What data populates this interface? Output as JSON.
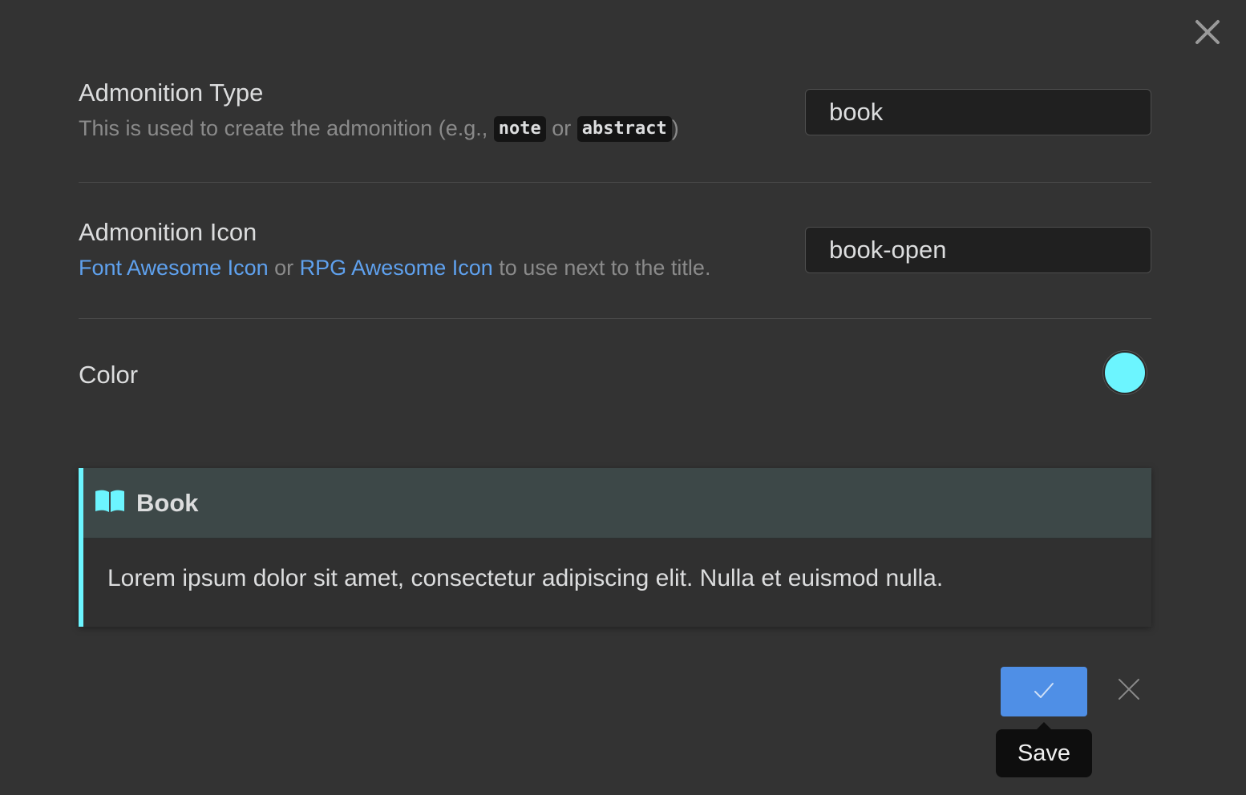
{
  "modal": {
    "close_icon": "close-icon"
  },
  "type_setting": {
    "name": "Admonition Type",
    "desc_prefix": "This is used to create the admonition (e.g., ",
    "code_1": "note",
    "desc_or": " or ",
    "code_2": "abstract",
    "desc_suffix": ")",
    "value": "book"
  },
  "icon_setting": {
    "name": "Admonition Icon",
    "link_1": "Font Awesome Icon",
    "desc_or": " or ",
    "link_2": "RPG Awesome Icon",
    "desc_suffix": " to use next to the title.",
    "value": "book-open"
  },
  "color_setting": {
    "name": "Color",
    "value": "#6cf5ff"
  },
  "preview": {
    "icon": "book-open-icon",
    "title": "Book",
    "content": "Lorem ipsum dolor sit amet, consectetur adipiscing elit. Nulla et euismod nulla.",
    "accent_color": "#6cf5ff"
  },
  "actions": {
    "save_icon": "checkmark-icon",
    "cancel_icon": "close-icon",
    "tooltip": "Save",
    "save_color": "#4f8fe6"
  }
}
